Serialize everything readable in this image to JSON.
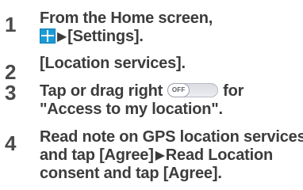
{
  "steps": [
    {
      "number": "1",
      "line1": "From the Home screen,",
      "line2_suffix": "[Settings]."
    },
    {
      "number": "2",
      "line1": "[Location services]."
    },
    {
      "number": "3",
      "line1_prefix": "Tap or drag right",
      "toggle_label": "OFF",
      "line1_suffix": "for",
      "line2": "\"Access to my location\"."
    },
    {
      "number": "4",
      "line1": "Read note on GPS location services",
      "line2_prefix": "and tap [Agree]",
      "line2_suffix": "Read Location",
      "line3": "consent and tap [Agree]."
    }
  ],
  "glyphs": {
    "arrow": "▶"
  },
  "icons": {
    "apps": "apps-grid-icon"
  },
  "colors": {
    "text": "#3c3c3c",
    "apps_icon": "#1a9ad6"
  }
}
